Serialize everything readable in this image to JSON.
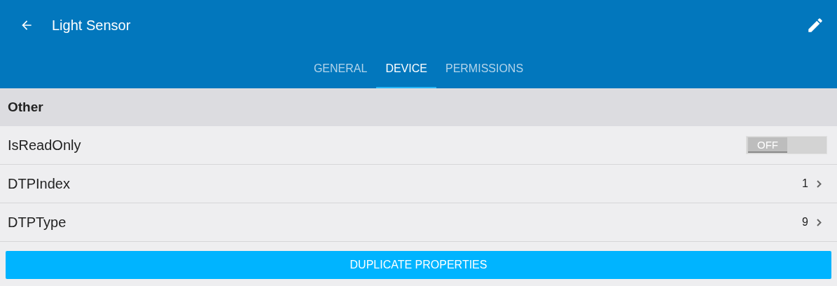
{
  "app_bar": {
    "title": "Light Sensor"
  },
  "tabs": [
    {
      "label": "GENERAL",
      "selected": false
    },
    {
      "label": "DEVICE",
      "selected": true
    },
    {
      "label": "PERMISSIONS",
      "selected": false
    }
  ],
  "section": {
    "title": "Other"
  },
  "rows": [
    {
      "kind": "toggle",
      "label": "IsReadOnly",
      "on": false,
      "state_text": "OFF"
    },
    {
      "kind": "value",
      "label": "DTPIndex",
      "value": "1"
    },
    {
      "kind": "value",
      "label": "DTPType",
      "value": "9"
    }
  ],
  "button": "DUPLICATE PROPERTIES"
}
